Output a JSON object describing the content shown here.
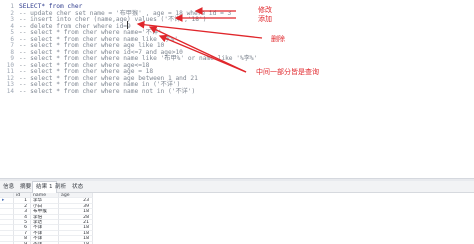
{
  "editor": {
    "lines": [
      {
        "num": "1",
        "text": "SELECT* from cher",
        "active": true
      },
      {
        "num": "2",
        "text": "-- update cher set name = '布甲猴' , age = 18 where id = 3",
        "active": false
      },
      {
        "num": "3",
        "text": "-- insert into cher (name,age) values ('不详','18')",
        "active": false
      },
      {
        "num": "4",
        "text": "-- delete from cher where id=9",
        "active": false
      },
      {
        "num": "5",
        "text": "-- select * from cher where name='不详'",
        "active": false
      },
      {
        "num": "6",
        "text": "-- select * from cher where name like '李%'",
        "active": false
      },
      {
        "num": "7",
        "text": "-- select * from cher where age like 10",
        "active": false
      },
      {
        "num": "8",
        "text": "-- select * from cher where id<=7 and age>10",
        "active": false
      },
      {
        "num": "9",
        "text": "-- select * from cher where name like '布甲%' or name like '%李%'",
        "active": false
      },
      {
        "num": "10",
        "text": "-- select * from cher where age<=18",
        "active": false
      },
      {
        "num": "11",
        "text": "-- select * from cher where age = 18",
        "active": false
      },
      {
        "num": "12",
        "text": "-- select * from cher where age between 1 and 21",
        "active": false
      },
      {
        "num": "13",
        "text": "-- select * from cher where name in ('不详')",
        "active": false
      },
      {
        "num": "14",
        "text": "-- select * from cher where name not in ('不详')",
        "active": false
      }
    ]
  },
  "annotations": {
    "modify": "修改",
    "add": "添加",
    "delete": "删除",
    "query": "中间一部分皆是查询"
  },
  "result": {
    "tabs": [
      "信息",
      "摘要",
      "结果 1",
      "剖析",
      "状态"
    ],
    "active_tab_index": 2,
    "columns": [
      "id",
      "name",
      "age"
    ],
    "rows": [
      {
        "id": "1",
        "name": "李华",
        "age": "23"
      },
      {
        "id": "2",
        "name": "小白",
        "age": "39"
      },
      {
        "id": "3",
        "name": "布甲猴",
        "age": "18"
      },
      {
        "id": "4",
        "name": "李倍",
        "age": "28"
      },
      {
        "id": "5",
        "name": "李达",
        "age": "21"
      },
      {
        "id": "6",
        "name": "不详",
        "age": "18"
      },
      {
        "id": "7",
        "name": "不详",
        "age": "18"
      },
      {
        "id": "8",
        "name": "不详",
        "age": "18"
      },
      {
        "id": "9",
        "name": "不详",
        "age": "18"
      }
    ],
    "row_indicator": "▸"
  },
  "colors": {
    "annotation": "#e0262b",
    "active_code": "#2d3a8c",
    "comment_code": "#7f8792"
  }
}
